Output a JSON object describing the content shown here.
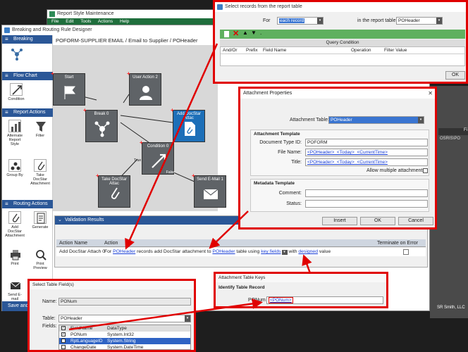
{
  "report_style": {
    "title": "Report Style Maintenance",
    "menu": [
      "File",
      "Edit",
      "Tools",
      "Actions",
      "Help"
    ]
  },
  "designer": {
    "title": "Breaking and Routing Rule Designer",
    "rule_path": "POFORM-SUPPLIER EMAIL / Email to Supplier / POHeader",
    "save_label": "Save and",
    "sidebar": {
      "breaking_header": "Breaking",
      "flowchart_header": "Flow Chart",
      "condition": "Condition",
      "report_actions_header": "Report Actions",
      "alternate_report_style": "Alternate Report Style",
      "filter": "Filter",
      "group_by": "Group By",
      "take_docstar_attachment": "Take DocStar Attachment",
      "routing_actions_header": "Routing Actions",
      "add_docstar_attachment": "Add DocStar Attachment",
      "generate": "Generate",
      "print": "Print",
      "print_preview": "Print Preview",
      "send_email": "Send E-mail"
    },
    "nodes": {
      "start": "Start",
      "user_action": "User Action 2",
      "break": "Break 0",
      "add_docstar": "Add DocStar Attac",
      "condition": "Condition 0",
      "take_docstar": "Take DocStar Attac",
      "send_email": "Send E-Mail 1",
      "true_label": "True",
      "false_label": "False"
    },
    "validation": {
      "title": "Validation Results",
      "headers": {
        "action_name": "Action Name",
        "action": "Action",
        "terminate": "Terminate on Error"
      },
      "row": {
        "name": "Add DocStar Attach 0",
        "t1": "For ",
        "l1": "POHeader",
        "t2": " records add DocStar attachment to ",
        "l2": "POHeader",
        "t3": " table using ",
        "l3": "key fields",
        "t4": " with ",
        "l4": "designed",
        "t5": " value"
      }
    }
  },
  "select_records": {
    "title": "Select records from the report table",
    "for_label": "For",
    "for_value": "each record",
    "table_label": "in the report table",
    "table_value": "POHeader",
    "query_title": "Query Condition",
    "columns": [
      "And/Or",
      "Prefix",
      "Field Name",
      "Operation",
      "Filter Value"
    ],
    "ok": "OK"
  },
  "attachment_props": {
    "title": "Attachment Properties",
    "table_label": "Attachment Table:",
    "table_value": "POHeader",
    "template_title": "Attachment Template",
    "doc_type_label": "Document Type ID:",
    "doc_type_value": "POFORM",
    "file_name_label": "File Name:",
    "file_name_value": "<POHeader>_<Today>_<CurrentTime>",
    "title_label": "Title:",
    "title_value": "<POHeader>_<Today>_<CurrentTime>",
    "allow_multiple": "Allow multiple attachments:",
    "metadata_title": "Metadata Template",
    "comment_label": "Comment:",
    "status_label": "Status:",
    "insert": "Insert",
    "ok": "OK",
    "cancel": "Cancel"
  },
  "background_right": {
    "header": "Fi",
    "path": "OSRIS\\PO",
    "footer": "SR Smith, LLC"
  },
  "table_keys": {
    "title": "Attachment Table Keys",
    "section": "Identify Table Record",
    "ponum_label": "PONum",
    "ponum_value": "<PONum>"
  },
  "select_fields": {
    "title": "Select Table Field(s)",
    "name_label": "Name:",
    "name_value": "PONum",
    "table_label": "Table:",
    "table_value": "POHeader",
    "fields_label": "Fields:",
    "headers": [
      "FieldName",
      "DataType"
    ],
    "rows": [
      {
        "name": "PONum",
        "type": "System.Int32"
      },
      {
        "name": "RptLanguageID",
        "type": "System.String"
      },
      {
        "name": "ChangeDate",
        "type": "System.DateTime"
      }
    ]
  }
}
